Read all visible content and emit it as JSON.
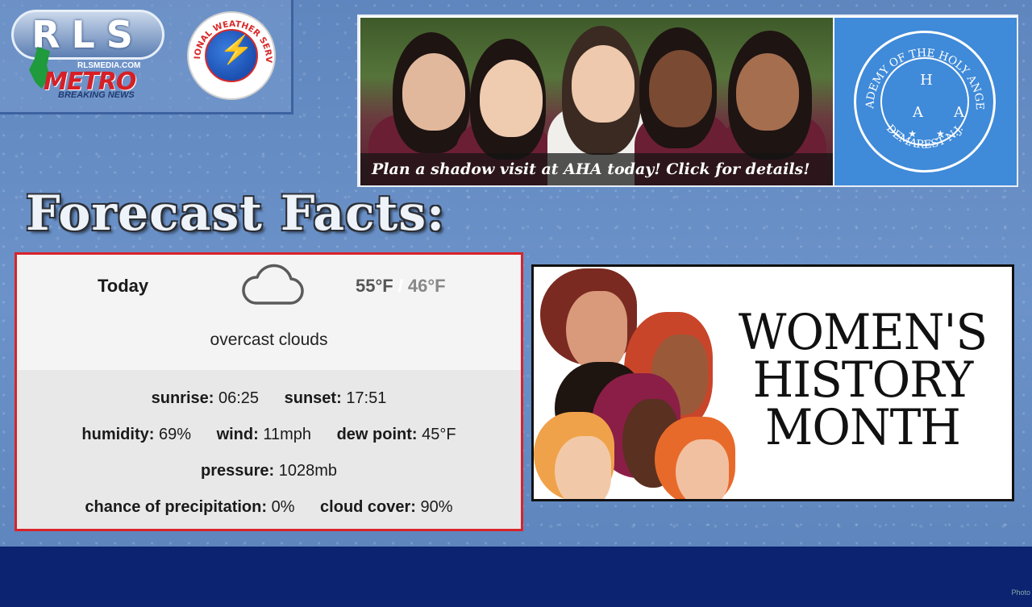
{
  "logos": {
    "rls": {
      "letters": "RLS",
      "url": "RLSMEDIA.COM",
      "metro": "METRO",
      "tagline": "BREAKING NEWS"
    },
    "nws": {
      "ring_text": "NATIONAL WEATHER SERVICE"
    }
  },
  "ad_banner": {
    "caption": "Plan a shadow visit at AHA today! Click for details!",
    "seal": {
      "ring_text_top": "ACADEMY OF THE HOLY ANGELS",
      "ring_text_bottom": "DEMAREST N.J.",
      "letters_top": "H",
      "letters_mid": "AA",
      "stars": "★★"
    }
  },
  "headline": "Forecast Facts:",
  "forecast": {
    "day": "Today",
    "icon": "cloud-icon",
    "high": "55°F",
    "separator": "/",
    "low": "46°F",
    "description": "overcast clouds",
    "sunrise_label": "sunrise:",
    "sunrise": "06:25",
    "sunset_label": "sunset:",
    "sunset": "17:51",
    "humidity_label": "humidity:",
    "humidity": "69%",
    "wind_label": "wind:",
    "wind": "11mph",
    "dew_point_label": "dew point:",
    "dew_point": "45°F",
    "pressure_label": "pressure:",
    "pressure": "1028mb",
    "precip_label": "chance of precipitation:",
    "precip": "0%",
    "cloud_cover_label": "cloud cover:",
    "cloud_cover": "90%"
  },
  "whm": {
    "line1": "WOMEN'S",
    "line2": "HISTORY",
    "line3": "MONTH"
  },
  "credit": "Photo",
  "colors": {
    "card_border": "#d9232a",
    "footer": "#0b2370",
    "background": "#6c93c9"
  }
}
